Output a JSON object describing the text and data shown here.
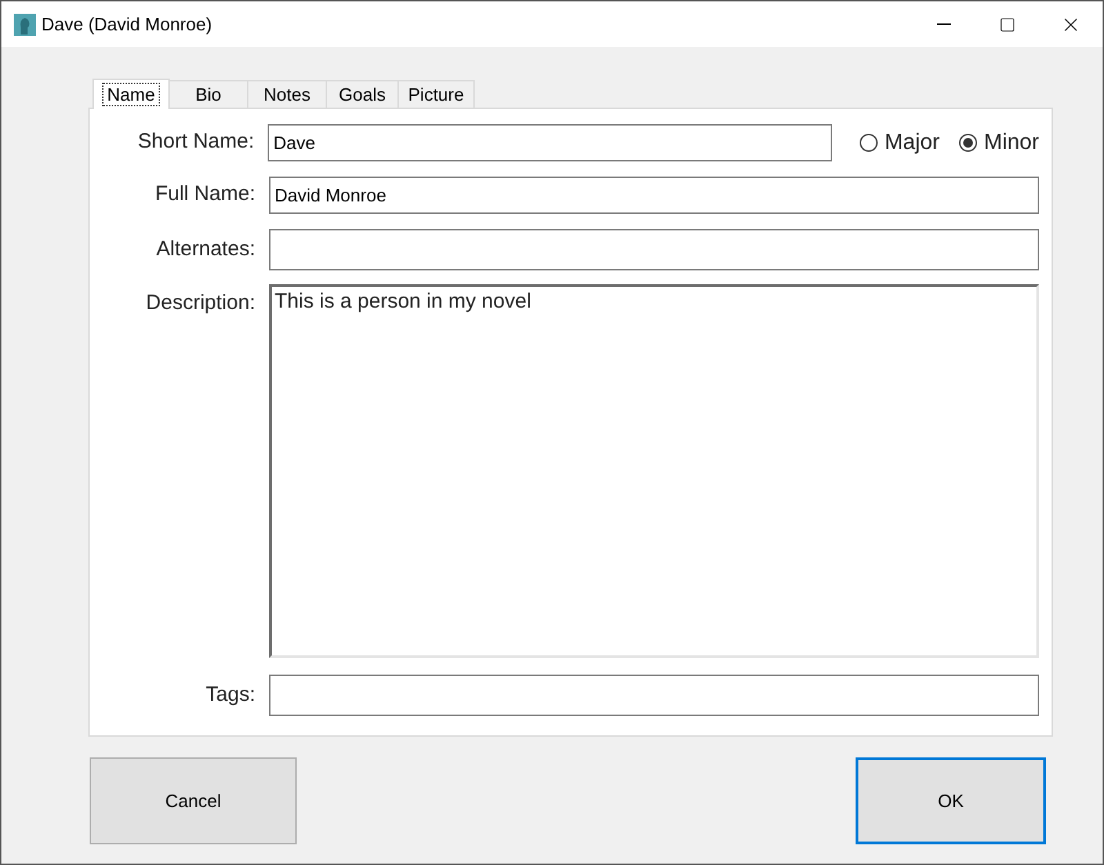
{
  "window": {
    "title": "Dave (David Monroe)"
  },
  "tabs": [
    {
      "label": "Name",
      "selected": true
    },
    {
      "label": "Bio",
      "selected": false
    },
    {
      "label": "Notes",
      "selected": false
    },
    {
      "label": "Goals",
      "selected": false
    },
    {
      "label": "Picture",
      "selected": false
    }
  ],
  "fields": [
    {
      "kind": "line",
      "label": "Short Name:",
      "value": "Dave",
      "options": [
        {
          "label": "Major",
          "selected": false
        },
        {
          "label": "Minor",
          "selected": true
        }
      ]
    },
    {
      "kind": "line",
      "label": "Full Name:",
      "value": "David Monroe"
    },
    {
      "kind": "line",
      "label": "Alternates:"
    },
    {
      "kind": "area",
      "label": "Description:",
      "value": "This is a person in my novel"
    },
    {
      "kind": "line",
      "label": "Tags:"
    }
  ],
  "buttons": [
    {
      "label": "Cancel",
      "default": false
    },
    {
      "label": "OK",
      "default": true
    }
  ]
}
